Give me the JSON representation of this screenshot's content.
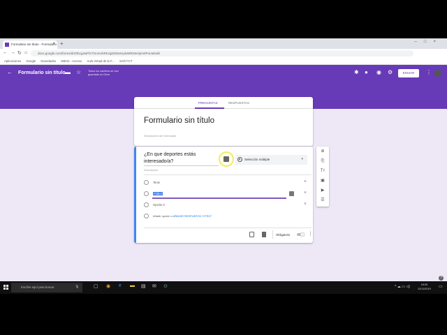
{
  "browser": {
    "tab_title": "Formulario sin título - Formulario",
    "url": "docs.google.com/forms/d/1Rbcg4wFhrTOomohRKzgi0S5tvHydobRD0emjKWPoLM/edit",
    "bookmarks": [
      "Aplicaciones",
      "Google",
      "Novedades",
      "DBCD - Acceso",
      "Aula Virtual de la F...",
      "SAÓ FCT"
    ]
  },
  "header": {
    "title": "Formulario sin título",
    "saved_status": "Todos los cambios se han guardado en Drive",
    "send_label": "ENVIAR"
  },
  "form": {
    "tabs": [
      "PREGUNTAS",
      "RESPUESTAS"
    ],
    "title": "Formulario sin título",
    "description_placeholder": "Descripción del formulario"
  },
  "question": {
    "text": "¿En que deportes estás interesado/a?",
    "type": "Selección múltiple",
    "description_placeholder": "Descripción",
    "options": [
      "Tenis",
      "Fútbol",
      "Opción 3"
    ],
    "add_option": "Añadir opción",
    "or": "o",
    "add_other": "AÑADIR RESPUESTA \"OTRO\"",
    "required_label": "Obligatorio"
  },
  "taskbar": {
    "search_placeholder": "Escribe aquí para buscar",
    "time": "18:25",
    "date": "12/11/2019"
  }
}
